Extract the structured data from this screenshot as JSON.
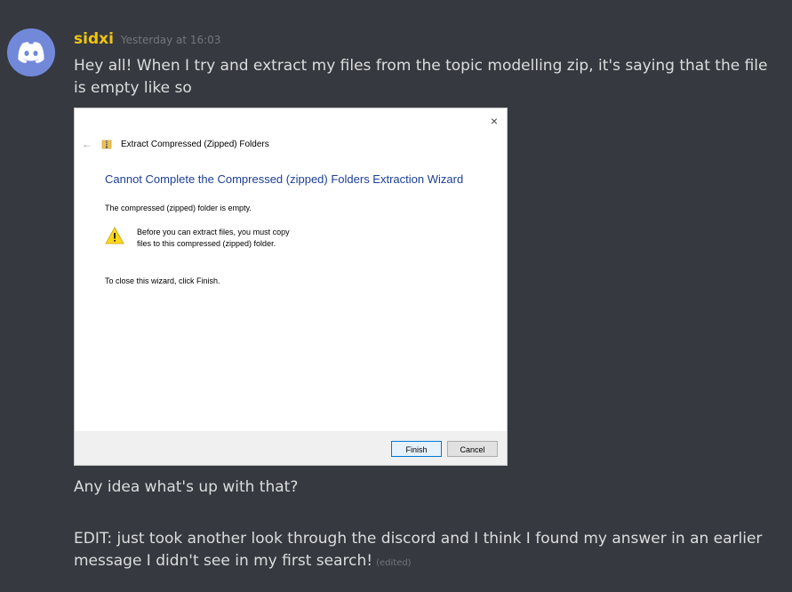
{
  "message": {
    "author": "sidxi",
    "timestamp": "Yesterday at 16:03",
    "line1": "Hey all! When I try and extract my files from the topic modelling zip, it's saying that the file is empty like so",
    "line2": "Any idea what's up with that?",
    "line3": "EDIT: just took another look through the discord and I think I found my answer in an earlier message I didn't see in my first search!",
    "edited_tag": "(edited)"
  },
  "dialog": {
    "header": "Extract Compressed (Zipped) Folders",
    "title": "Cannot Complete the Compressed (zipped) Folders Extraction Wizard",
    "empty_text": "The compressed (zipped) folder is empty.",
    "warning_text": "Before you can extract files, you must copy files to this compressed (zipped) folder.",
    "close_text": "To close this wizard, click Finish.",
    "finish_label": "Finish",
    "cancel_label": "Cancel",
    "close_glyph": "×",
    "back_glyph": "←"
  },
  "colors": {
    "background": "#36393f",
    "username": "#f1c40f",
    "avatar": "#7289da",
    "wizard_title": "#1c3f94"
  },
  "icons": [
    "discord-logo-icon",
    "zip-folder-icon",
    "warning-icon",
    "close-icon",
    "back-arrow-icon"
  ]
}
